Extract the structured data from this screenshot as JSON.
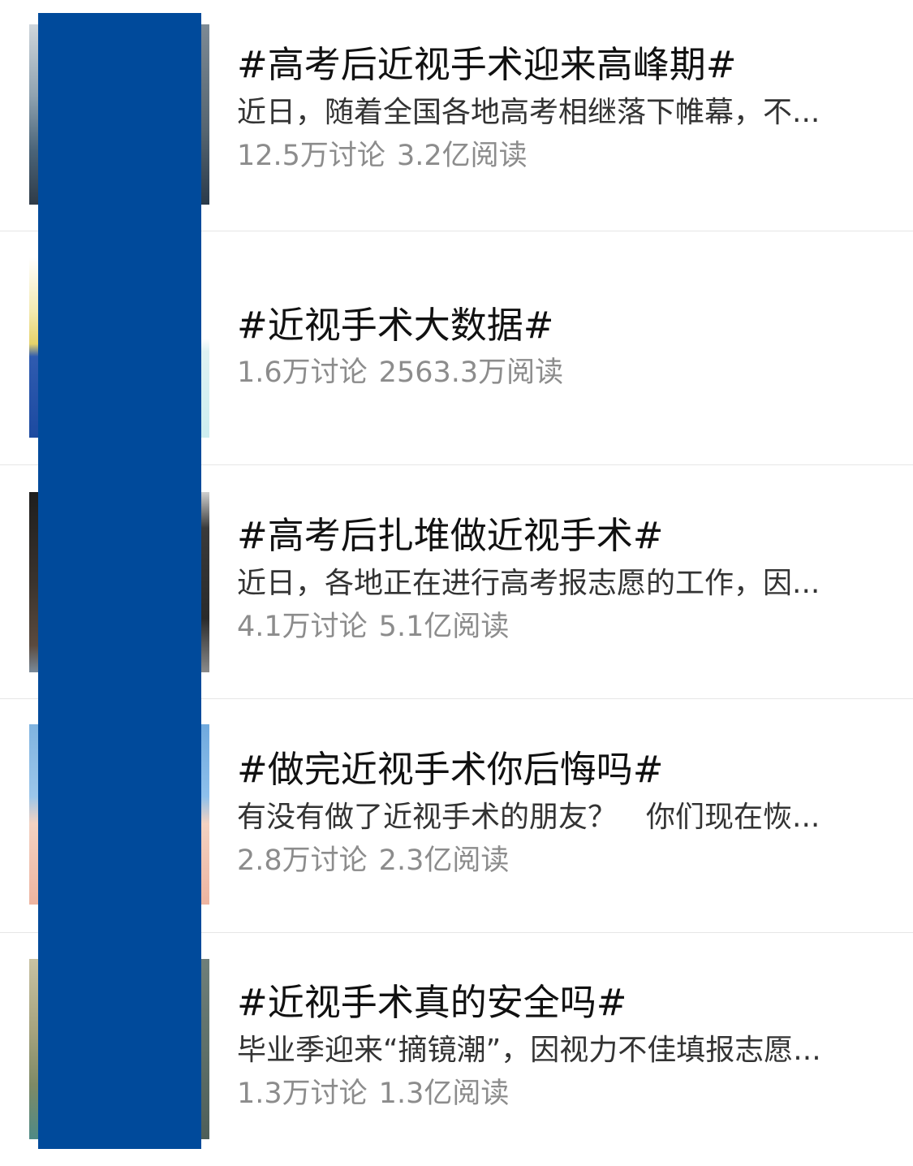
{
  "redaction_color": "#004a9b",
  "topics": [
    {
      "title": "#高考后近视手术迎来高峰期#",
      "description": "近日，随着全国各地高考相继落下帷幕，不...",
      "discussions": "12.5万讨论",
      "reads": "3.2亿阅读"
    },
    {
      "title": "#近视手术大数据#",
      "description": "",
      "discussions": "1.6万讨论",
      "reads": "2563.3万阅读"
    },
    {
      "title": "#高考后扎堆做近视手术#",
      "description": "近日，各地正在进行高考报志愿的工作，因...",
      "discussions": "4.1万讨论",
      "reads": "5.1亿阅读"
    },
    {
      "title": "#做完近视手术你后悔吗#",
      "description": "有没有做了近视手术的朋友？　你们现在恢...",
      "discussions": "2.8万讨论",
      "reads": "2.3亿阅读"
    },
    {
      "title": "#近视手术真的安全吗#",
      "description": "毕业季迎来“摘镜潮”，因视力不佳填报志愿...",
      "discussions": "1.3万讨论",
      "reads": "1.3亿阅读"
    }
  ]
}
